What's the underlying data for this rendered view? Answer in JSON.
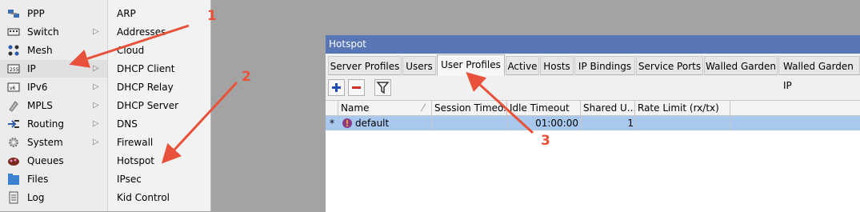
{
  "left_menu": {
    "items": [
      {
        "label": "PPP",
        "icon": "ppp-icon",
        "arrow": ""
      },
      {
        "label": "Switch",
        "icon": "switch-icon",
        "arrow": "▷"
      },
      {
        "label": "Mesh",
        "icon": "mesh-icon",
        "arrow": ""
      },
      {
        "label": "IP",
        "icon": "ip-icon",
        "arrow": "▷"
      },
      {
        "label": "IPv6",
        "icon": "ipv6-icon",
        "arrow": "▷"
      },
      {
        "label": "MPLS",
        "icon": "mpls-icon",
        "arrow": "▷"
      },
      {
        "label": "Routing",
        "icon": "routing-icon",
        "arrow": "▷"
      },
      {
        "label": "System",
        "icon": "system-icon",
        "arrow": "▷"
      },
      {
        "label": "Queues",
        "icon": "queues-icon",
        "arrow": ""
      },
      {
        "label": "Files",
        "icon": "files-icon",
        "arrow": ""
      },
      {
        "label": "Log",
        "icon": "log-icon",
        "arrow": ""
      }
    ]
  },
  "submenu": {
    "items": [
      "ARP",
      "Addresses",
      "Cloud",
      "DHCP Client",
      "DHCP Relay",
      "DHCP Server",
      "DNS",
      "Firewall",
      "Hotspot",
      "IPsec",
      "Kid Control"
    ]
  },
  "window": {
    "title": "Hotspot",
    "tabs": [
      "Server Profiles",
      "Users",
      "User Profiles",
      "Active",
      "Hosts",
      "IP Bindings",
      "Service Ports",
      "Walled Garden",
      "Walled Garden IP"
    ],
    "active_tab": "User Profiles",
    "toolbar": {
      "add": "+",
      "remove": "−",
      "filter": "filter-icon"
    },
    "table": {
      "columns": [
        "Name",
        "Session Timeo...",
        "Idle Timeout",
        "Shared U...",
        "Rate Limit (rx/tx)"
      ],
      "rows": [
        {
          "flag": "*",
          "name": "default",
          "session_timeout": "",
          "idle_timeout": "01:00:00",
          "shared_users": "1",
          "rate_limit": ""
        }
      ]
    }
  },
  "annotations": {
    "one": "1",
    "two": "2",
    "three": "3",
    "color": "#e8513a"
  }
}
